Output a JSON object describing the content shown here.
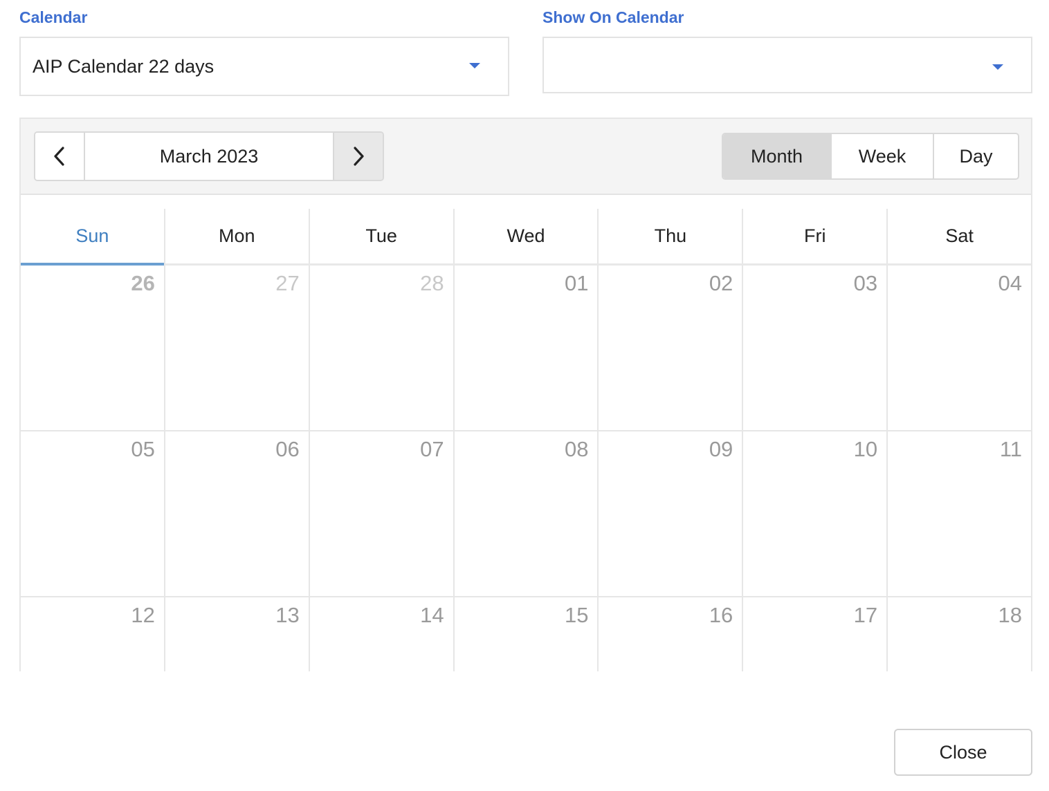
{
  "calendar_field": {
    "label": "Calendar",
    "value": "AIP Calendar 22 days"
  },
  "show_on_field": {
    "label": "Show On Calendar",
    "value": ""
  },
  "toolbar": {
    "title": "March 2023",
    "views": [
      "Month",
      "Week",
      "Day"
    ],
    "active_view": "Month"
  },
  "weekdays": [
    "Sun",
    "Mon",
    "Tue",
    "Wed",
    "Thu",
    "Fri",
    "Sat"
  ],
  "weeks": [
    [
      "26",
      "27",
      "28",
      "01",
      "02",
      "03",
      "04"
    ],
    [
      "05",
      "06",
      "07",
      "08",
      "09",
      "10",
      "11"
    ],
    [
      "12",
      "13",
      "14",
      "15",
      "16",
      "17",
      "18"
    ]
  ],
  "footer": {
    "close_label": "Close"
  },
  "colors": {
    "accent": "#3f6fd0",
    "active_tab": "#3f7fc0",
    "view_active_bg": "#d9d9d9"
  }
}
